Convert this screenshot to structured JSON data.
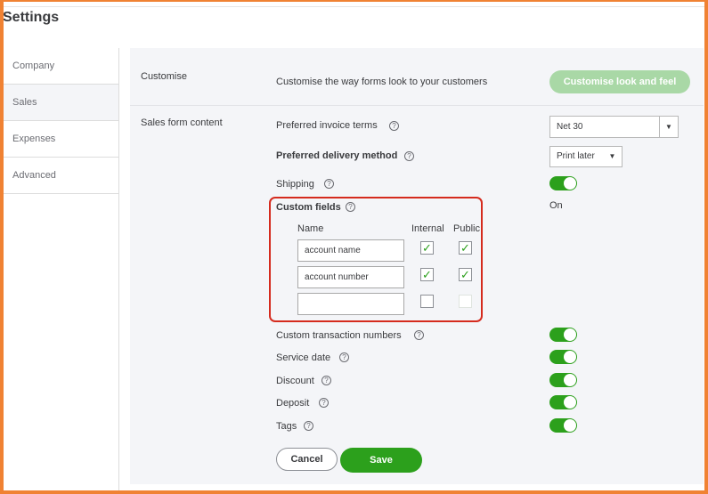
{
  "header": {
    "title": "Settings"
  },
  "sidebar": {
    "items": [
      {
        "label": "Company"
      },
      {
        "label": "Sales"
      },
      {
        "label": "Expenses"
      },
      {
        "label": "Advanced"
      }
    ],
    "active": "Sales"
  },
  "customise": {
    "section_label": "Customise",
    "description": "Customise the way forms look to your customers",
    "button_label": "Customise look and feel"
  },
  "sales_form": {
    "section_label": "Sales form content",
    "invoice_terms": {
      "label": "Preferred invoice terms",
      "value": "Net 30"
    },
    "delivery_method": {
      "label": "Preferred delivery method",
      "value": "Print later"
    },
    "shipping": {
      "label": "Shipping",
      "state": "On"
    },
    "custom_fields": {
      "label": "Custom fields",
      "headers": {
        "name": "Name",
        "internal": "Internal",
        "public": "Public"
      },
      "rows": [
        {
          "name": "account name",
          "internal": true,
          "public": true
        },
        {
          "name": "account number",
          "internal": true,
          "public": true
        },
        {
          "name": "",
          "internal": false,
          "public": false
        }
      ]
    },
    "toggles": [
      {
        "label": "Custom transaction numbers",
        "on": true
      },
      {
        "label": "Service date",
        "on": true
      },
      {
        "label": "Discount",
        "on": true
      },
      {
        "label": "Deposit",
        "on": true
      },
      {
        "label": "Tags",
        "on": true
      }
    ]
  },
  "actions": {
    "cancel_label": "Cancel",
    "save_label": "Save"
  },
  "colors": {
    "accent": "#2ca01c",
    "frame": "#f08233",
    "highlight": "#d52b1e"
  },
  "icons": {
    "help": "question-circle-icon",
    "check": "checkmark-icon",
    "dropdown": "chevron-down-icon"
  }
}
